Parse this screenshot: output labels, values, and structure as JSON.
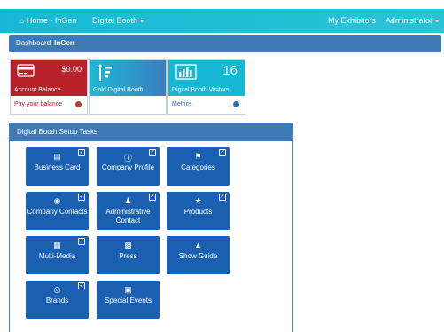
{
  "navbar": {
    "home_label": "Home - InGen",
    "digital_booth_label": "Digital Booth",
    "my_exhibitors_label": "My Exhibitors",
    "administrator_label": "Administrator",
    "bg_color": "#17b8d6"
  },
  "breadcrumb": {
    "root": "Dashboard",
    "current": "InGen"
  },
  "tiles": [
    {
      "label": "Account Balance",
      "value": "$0.00",
      "footer": "Pay your balance",
      "color": "#b8202a"
    },
    {
      "label": "Gold Digital Booth",
      "value": "",
      "footer": "",
      "color": "#1fb7d4"
    },
    {
      "label": "Digital Booth Visitors",
      "value": "16",
      "footer": "Metrics",
      "color": "#17b8d6"
    }
  ],
  "setup_panel": {
    "title": "Digital Booth Setup Tasks",
    "tasks": [
      {
        "label": "Business Card",
        "icon": "id-card-icon",
        "checked": true
      },
      {
        "label": "Company Profile",
        "icon": "info-icon",
        "checked": true
      },
      {
        "label": "Categories",
        "icon": "tags-icon",
        "checked": true
      },
      {
        "label": "Company Contacts",
        "icon": "contacts-icon",
        "checked": true
      },
      {
        "label": "Administrative Contact",
        "icon": "user-icon",
        "checked": true
      },
      {
        "label": "Products",
        "icon": "trophy-icon",
        "checked": true
      },
      {
        "label": "Multi-Media",
        "icon": "image-icon",
        "checked": true
      },
      {
        "label": "Press",
        "icon": "newspaper-icon",
        "checked": false
      },
      {
        "label": "Show Guide",
        "icon": "book-icon",
        "checked": false
      },
      {
        "label": "Brands",
        "icon": "target-icon",
        "checked": true
      },
      {
        "label": "Special Events",
        "icon": "calendar-icon",
        "checked": false
      }
    ]
  }
}
